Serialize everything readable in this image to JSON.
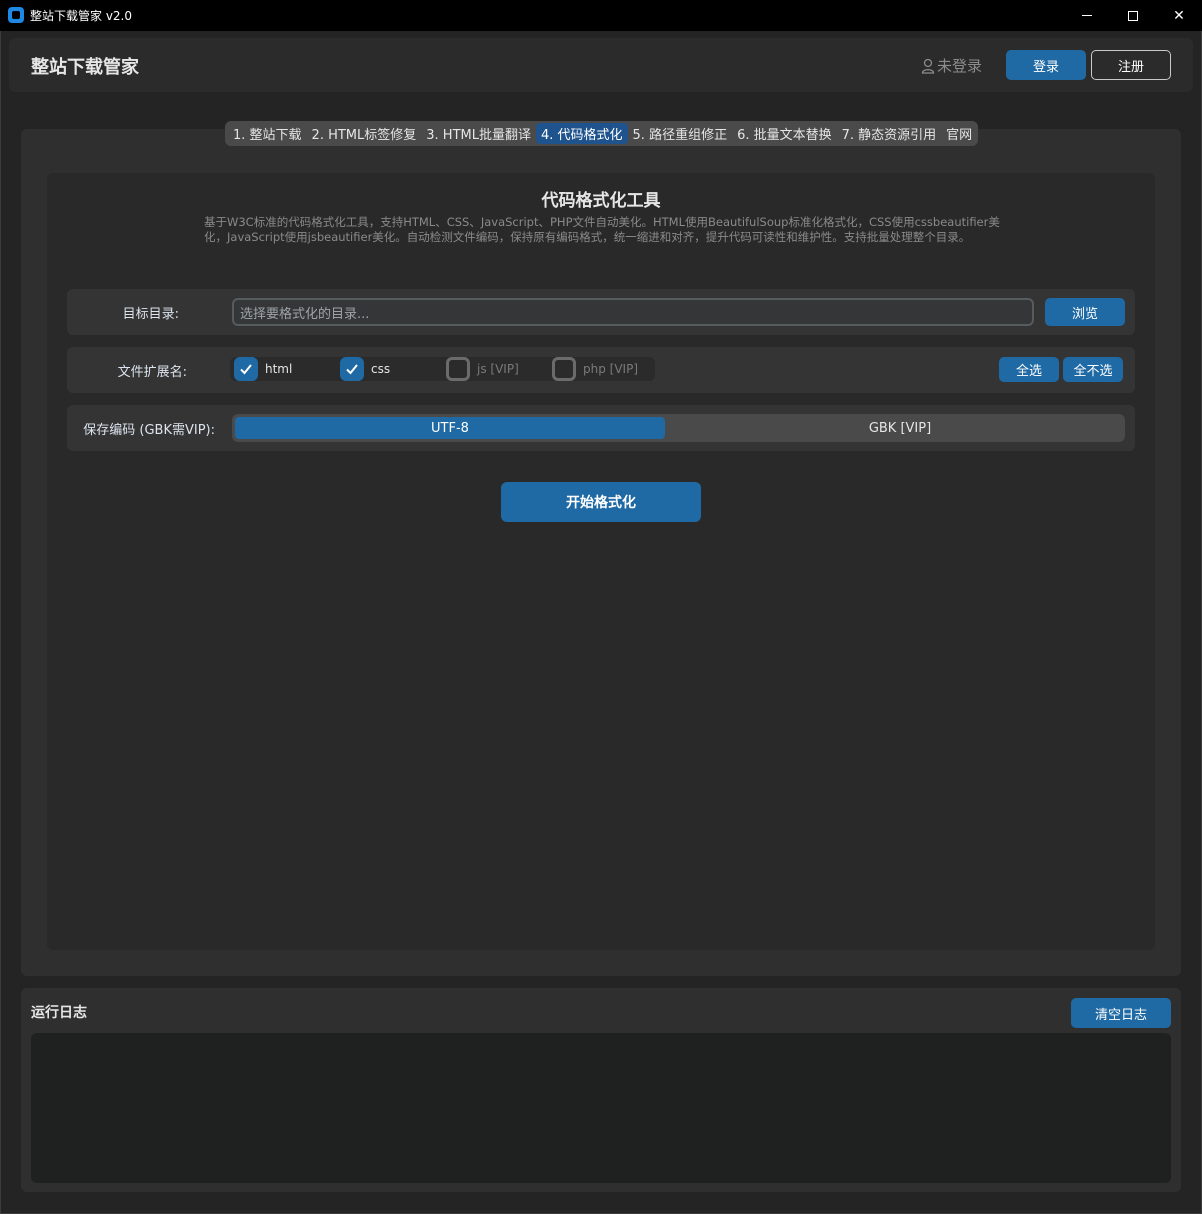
{
  "window": {
    "title": "整站下载管家 v2.0"
  },
  "header": {
    "app_name": "整站下载管家",
    "login_status": "未登录",
    "login_label": "登录",
    "register_label": "注册"
  },
  "tabs": [
    {
      "label": "1. 整站下载",
      "active": false
    },
    {
      "label": "2. HTML标签修复",
      "active": false
    },
    {
      "label": "3. HTML批量翻译",
      "active": false
    },
    {
      "label": "4. 代码格式化",
      "active": true
    },
    {
      "label": "5. 路径重组修正",
      "active": false
    },
    {
      "label": "6. 批量文本替换",
      "active": false
    },
    {
      "label": "7. 静态资源引用",
      "active": false
    },
    {
      "label": "官网",
      "active": false
    }
  ],
  "tool": {
    "title": "代码格式化工具",
    "description": "基于W3C标准的代码格式化工具，支持HTML、CSS、JavaScript、PHP文件自动美化。HTML使用BeautifulSoup标准化格式化，CSS使用cssbeautifier美化，JavaScript使用jsbeautifier美化。自动检测文件编码，保持原有编码格式，统一缩进和对齐，提升代码可读性和维护性。支持批量处理整个目录。",
    "target_dir_label": "目标目录:",
    "target_dir_placeholder": "选择要格式化的目录...",
    "browse_label": "浏览",
    "ext_label": "文件扩展名:",
    "extensions": [
      {
        "label": "html",
        "checked": true
      },
      {
        "label": "css",
        "checked": true
      },
      {
        "label": "js [VIP]",
        "checked": false
      },
      {
        "label": "php [VIP]",
        "checked": false
      }
    ],
    "select_all_label": "全选",
    "select_none_label": "全不选",
    "encoding_label": "保存编码 (GBK需VIP):",
    "encoding_options": [
      "UTF-8",
      "GBK [VIP]"
    ],
    "encoding_selected": "UTF-8",
    "start_label": "开始格式化"
  },
  "log": {
    "title": "运行日志",
    "clear_label": "清空日志"
  }
}
